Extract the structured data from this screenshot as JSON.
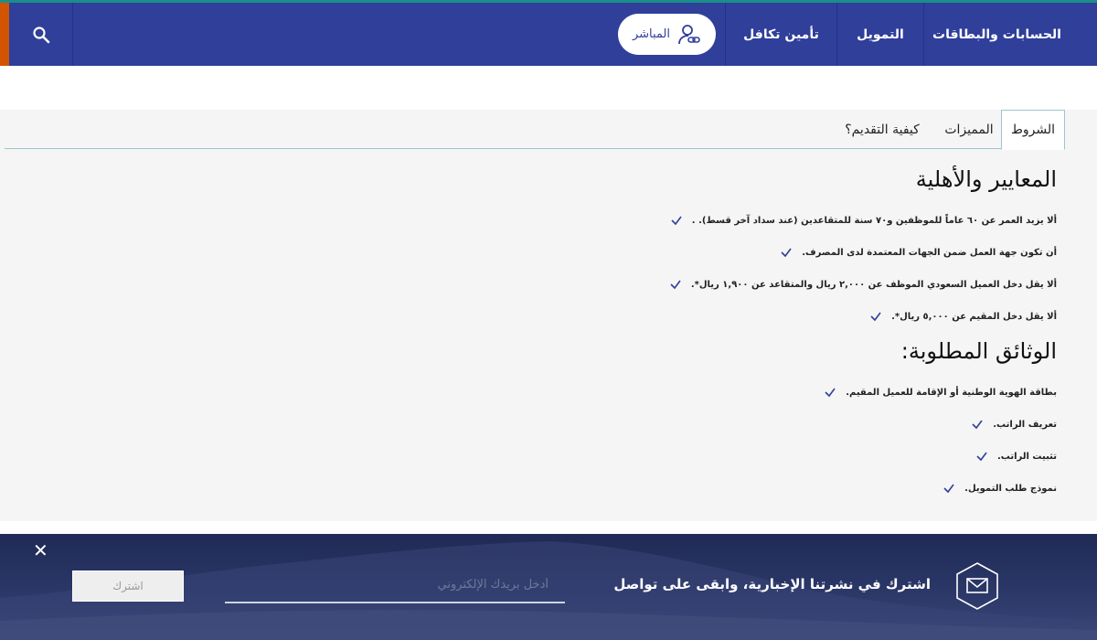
{
  "nav": {
    "items": [
      {
        "label": "الحسابات والبطاقات"
      },
      {
        "label": "التمويل"
      },
      {
        "label": "تأمين تكافل"
      }
    ],
    "direct_label": "المباشر"
  },
  "tabs": [
    {
      "label": "الشروط",
      "active": true
    },
    {
      "label": "المميزات"
    },
    {
      "label": "كيفية التقديم؟"
    }
  ],
  "criteria": {
    "title": "المعايير والأهلية",
    "items": [
      "ألا يزيد العمر عن ٦٠ عاماً للموظفين و٧٠ سنة للمتقاعدين (عند سداد آخر قسط). .",
      "أن تكون جهة العمل ضمن الجهات المعتمدة لدى المصرف.",
      "ألا يقل دخل العميل السعودي الموظف عن ٢,٠٠٠ ريال والمتقاعد عن ١,٩٠٠ ريال*.",
      "ألا يقل دخل المقيم عن ٥,٠٠٠ ريال*."
    ]
  },
  "documents": {
    "title": "الوثائق المطلوبة:",
    "items": [
      "بطاقة الهوية الوطنية أو الإقامة للعميل المقيم.",
      "تعريف الراتب.",
      "تثبيت الراتب.",
      "نموذج طلب التمويل."
    ]
  },
  "newsletter": {
    "text": "اشترك في نشرتنا الإخبارية، وابقى على تواصل",
    "email_placeholder": "أدخل بريدك الإلكتروني",
    "subscribe_label": "اشترك",
    "close_label": "✕"
  },
  "colors": {
    "nav_bg": "#2f3f9a",
    "accent": "#d35400",
    "check": "#2f3f9a"
  }
}
